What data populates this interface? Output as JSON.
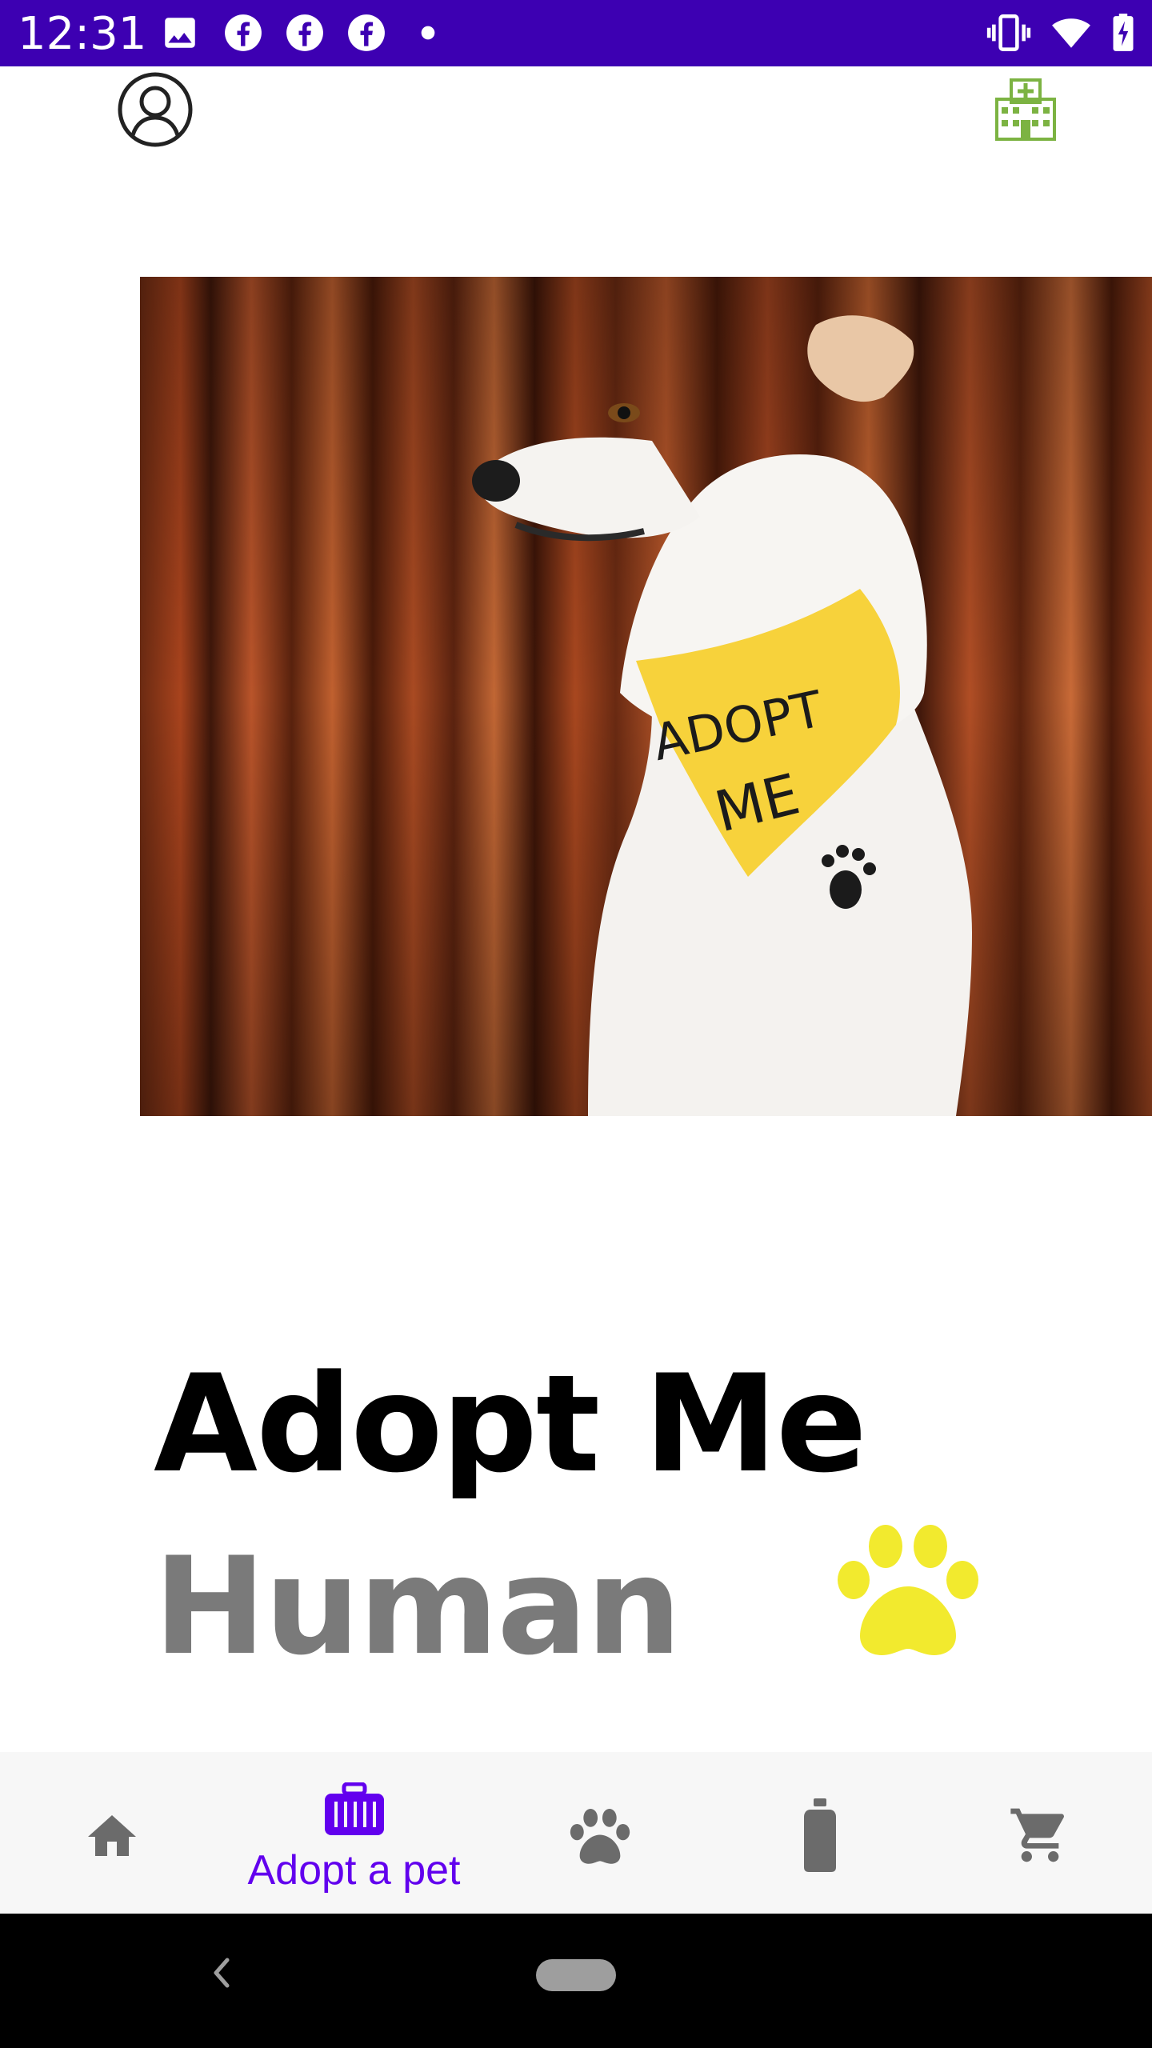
{
  "status_bar": {
    "time": "12:31",
    "background": "#3d00b2",
    "left_icons": [
      "image-icon",
      "facebook-icon",
      "facebook-icon",
      "facebook-icon",
      "dot-icon"
    ],
    "right_icons": [
      "vibrate-icon",
      "wifi-icon",
      "battery-charging-icon"
    ]
  },
  "header": {
    "left_icon": "profile-icon",
    "right_icon": "hospital-icon",
    "accent": "#7cb342"
  },
  "hero": {
    "description_icon": "dog-photo",
    "bandana_text_line1": "ADOPT",
    "bandana_text_line2": "ME"
  },
  "main": {
    "title": "Adopt Me",
    "subtitle": "Human",
    "paw_color": "#f2ea2e"
  },
  "bottom_nav": {
    "active_color": "#6200ee",
    "inactive_color": "#6b6b6b",
    "items": [
      {
        "icon": "home-icon",
        "label": ""
      },
      {
        "icon": "pet-carrier-icon",
        "label": "Adopt a pet"
      },
      {
        "icon": "paw-icon",
        "label": ""
      },
      {
        "icon": "bottle-icon",
        "label": ""
      },
      {
        "icon": "cart-icon",
        "label": ""
      }
    ]
  }
}
